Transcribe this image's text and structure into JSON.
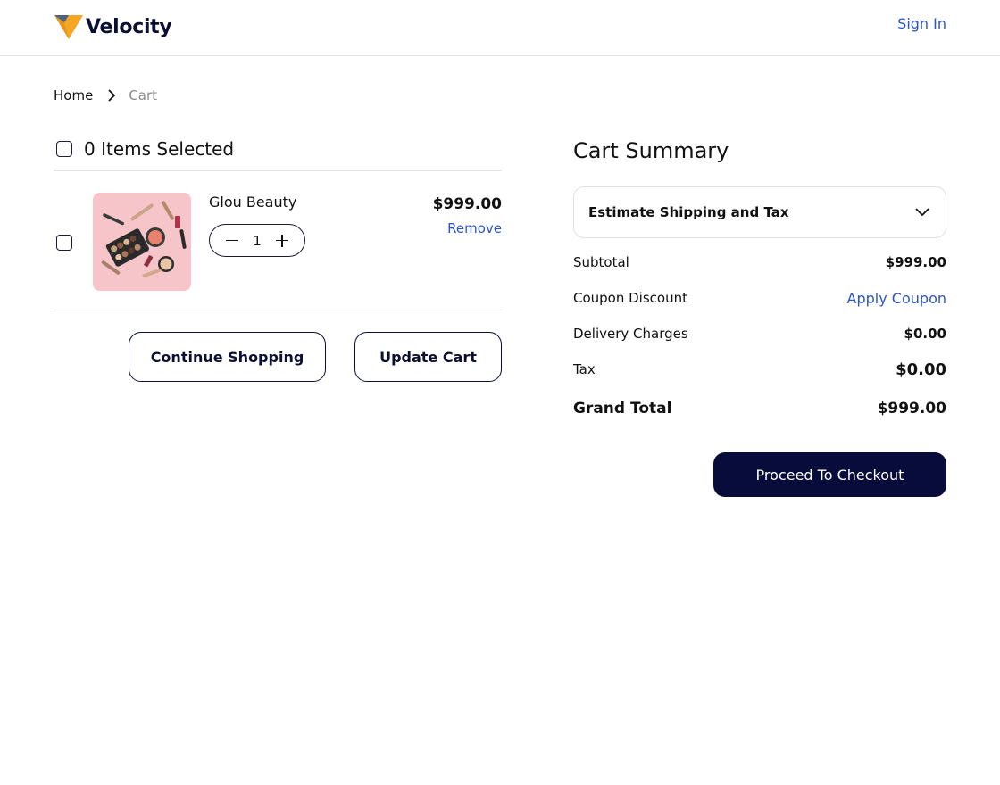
{
  "header": {
    "brand": "Velocity",
    "sign_in": "Sign In"
  },
  "breadcrumb": {
    "home": "Home",
    "current": "Cart"
  },
  "cart": {
    "select_all_label": "0 Items Selected",
    "items": [
      {
        "name": "Glou Beauty",
        "quantity": "1",
        "price": "$999.00",
        "remove_label": "Remove",
        "image": "makeup-products-photo"
      }
    ],
    "continue_label": "Continue Shopping",
    "update_label": "Update Cart"
  },
  "summary": {
    "title": "Cart Summary",
    "estimate_label": "Estimate Shipping and Tax",
    "subtotal_label": "Subtotal",
    "subtotal_value": "$999.00",
    "coupon_label": "Coupon Discount",
    "coupon_action": "Apply Coupon",
    "delivery_label": "Delivery Charges",
    "delivery_value": "$0.00",
    "tax_label": "Tax",
    "tax_value": "$0.00",
    "grand_total_label": "Grand Total",
    "grand_total_value": "$999.00",
    "checkout_label": "Proceed To Checkout"
  },
  "colors": {
    "brand_navy": "#070c3b",
    "link_blue": "#2b56c9",
    "logo_orange": "#f5a623",
    "logo_slate": "#4a6382"
  }
}
